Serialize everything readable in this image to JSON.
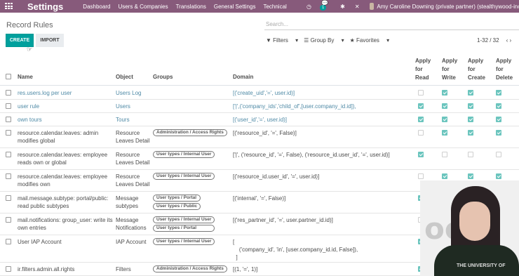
{
  "navbar": {
    "brand": "Settings",
    "menu": [
      "Dashboard",
      "Users & Companies",
      "Translations",
      "General Settings",
      "Technical"
    ],
    "message_count": "1",
    "user_name": "Amy Caroline Downing (private partner) (stealthywood-inc)"
  },
  "control_panel": {
    "breadcrumb": "Record Rules",
    "search_placeholder": "Search...",
    "create_label": "CREATE",
    "import_label": "IMPORT",
    "filters_label": "Filters",
    "groupby_label": "Group By",
    "favorites_label": "Favorites",
    "pager": "1-32 / 32"
  },
  "table": {
    "headers": {
      "name": "Name",
      "object": "Object",
      "groups": "Groups",
      "domain": "Domain",
      "apply_read": [
        "Apply",
        "for",
        "Read"
      ],
      "apply_write": [
        "Apply",
        "for",
        "Write"
      ],
      "apply_create": [
        "Apply",
        "for",
        "Create"
      ],
      "apply_delete": [
        "Apply",
        "for",
        "Delete"
      ]
    },
    "rows": [
      {
        "name": [
          "res.users.log per user"
        ],
        "object": [
          "Users Log"
        ],
        "groups": [],
        "domain": [
          "[('create_uid','=', user.id)]"
        ],
        "perms": [
          false,
          true,
          true,
          true
        ]
      },
      {
        "name": [
          "user rule"
        ],
        "object": [
          "Users"
        ],
        "groups": [],
        "domain": [
          "['|',('company_ids','child_of',[user.company_id.id]),"
        ],
        "perms": [
          true,
          true,
          true,
          true
        ]
      },
      {
        "name": [
          "own tours"
        ],
        "object": [
          "Tours"
        ],
        "groups": [],
        "domain": [
          "[('user_id','=', user.id)]"
        ],
        "perms": [
          true,
          true,
          true,
          true
        ]
      },
      {
        "name": [
          "resource.calendar.leaves: admin",
          "modifies global"
        ],
        "object": [
          "Resource",
          "Leaves Detail"
        ],
        "groups": [
          "Administration / Access Rights"
        ],
        "domain": [
          "[('resource_id', '=', False)]"
        ],
        "perms": [
          false,
          true,
          true,
          true
        ]
      },
      {
        "name": [
          "resource.calendar.leaves: employee",
          "reads own or global"
        ],
        "object": [
          "Resource",
          "Leaves Detail"
        ],
        "groups": [
          "User types / Internal User"
        ],
        "domain": [
          "['|', ('resource_id', '=', False), ('resource_id.user_id', '=', user.id)]"
        ],
        "perms": [
          true,
          false,
          false,
          false
        ]
      },
      {
        "name": [
          "resource.calendar.leaves: employee",
          "modifies own"
        ],
        "object": [
          "Resource",
          "Leaves Detail"
        ],
        "groups": [
          "User types / Internal User"
        ],
        "domain": [
          "[('resource_id.user_id', '=', user.id)]"
        ],
        "perms": [
          false,
          true,
          true,
          true
        ]
      },
      {
        "name": [
          "mail.message.subtype: portal/public:",
          "read public subtypes"
        ],
        "object": [
          "Message",
          "subtypes"
        ],
        "groups": [
          "User types / Portal",
          "User types / Public"
        ],
        "domain": [
          "[('internal', '=', False)]"
        ],
        "perms": [
          true,
          false,
          false,
          false
        ]
      },
      {
        "name": [
          "mail.notifications: group_user: write its",
          "own entries"
        ],
        "object": [
          "Message",
          "Notifications"
        ],
        "groups": [
          "User types / Internal User",
          "User types / Portal"
        ],
        "domain": [
          "[('res_partner_id', '=', user.partner_id.id)]"
        ],
        "perms": [
          false,
          false,
          false,
          false
        ]
      },
      {
        "name": [
          "User IAP Account"
        ],
        "object": [
          "IAP Account"
        ],
        "groups": [
          "User types / Internal User"
        ],
        "domain": [
          "[",
          "    ('company_id', 'in', [user.company_id.id, False]),",
          "  ]"
        ],
        "perms": [
          true,
          false,
          false,
          false
        ]
      },
      {
        "name": [
          "ir.filters.admin.all.rights"
        ],
        "object": [
          "Filters"
        ],
        "groups": [
          "Administration / Access Rights"
        ],
        "domain": [
          "[(1, '=', 1)]"
        ],
        "perms": [
          true,
          false,
          false,
          false
        ]
      }
    ]
  },
  "webcam": {
    "shirt_text": "THE UNIVERSITY OF"
  },
  "colors": {
    "navbar": "#875a7b",
    "primary": "#00a09d",
    "link": "#4f8aa6"
  }
}
